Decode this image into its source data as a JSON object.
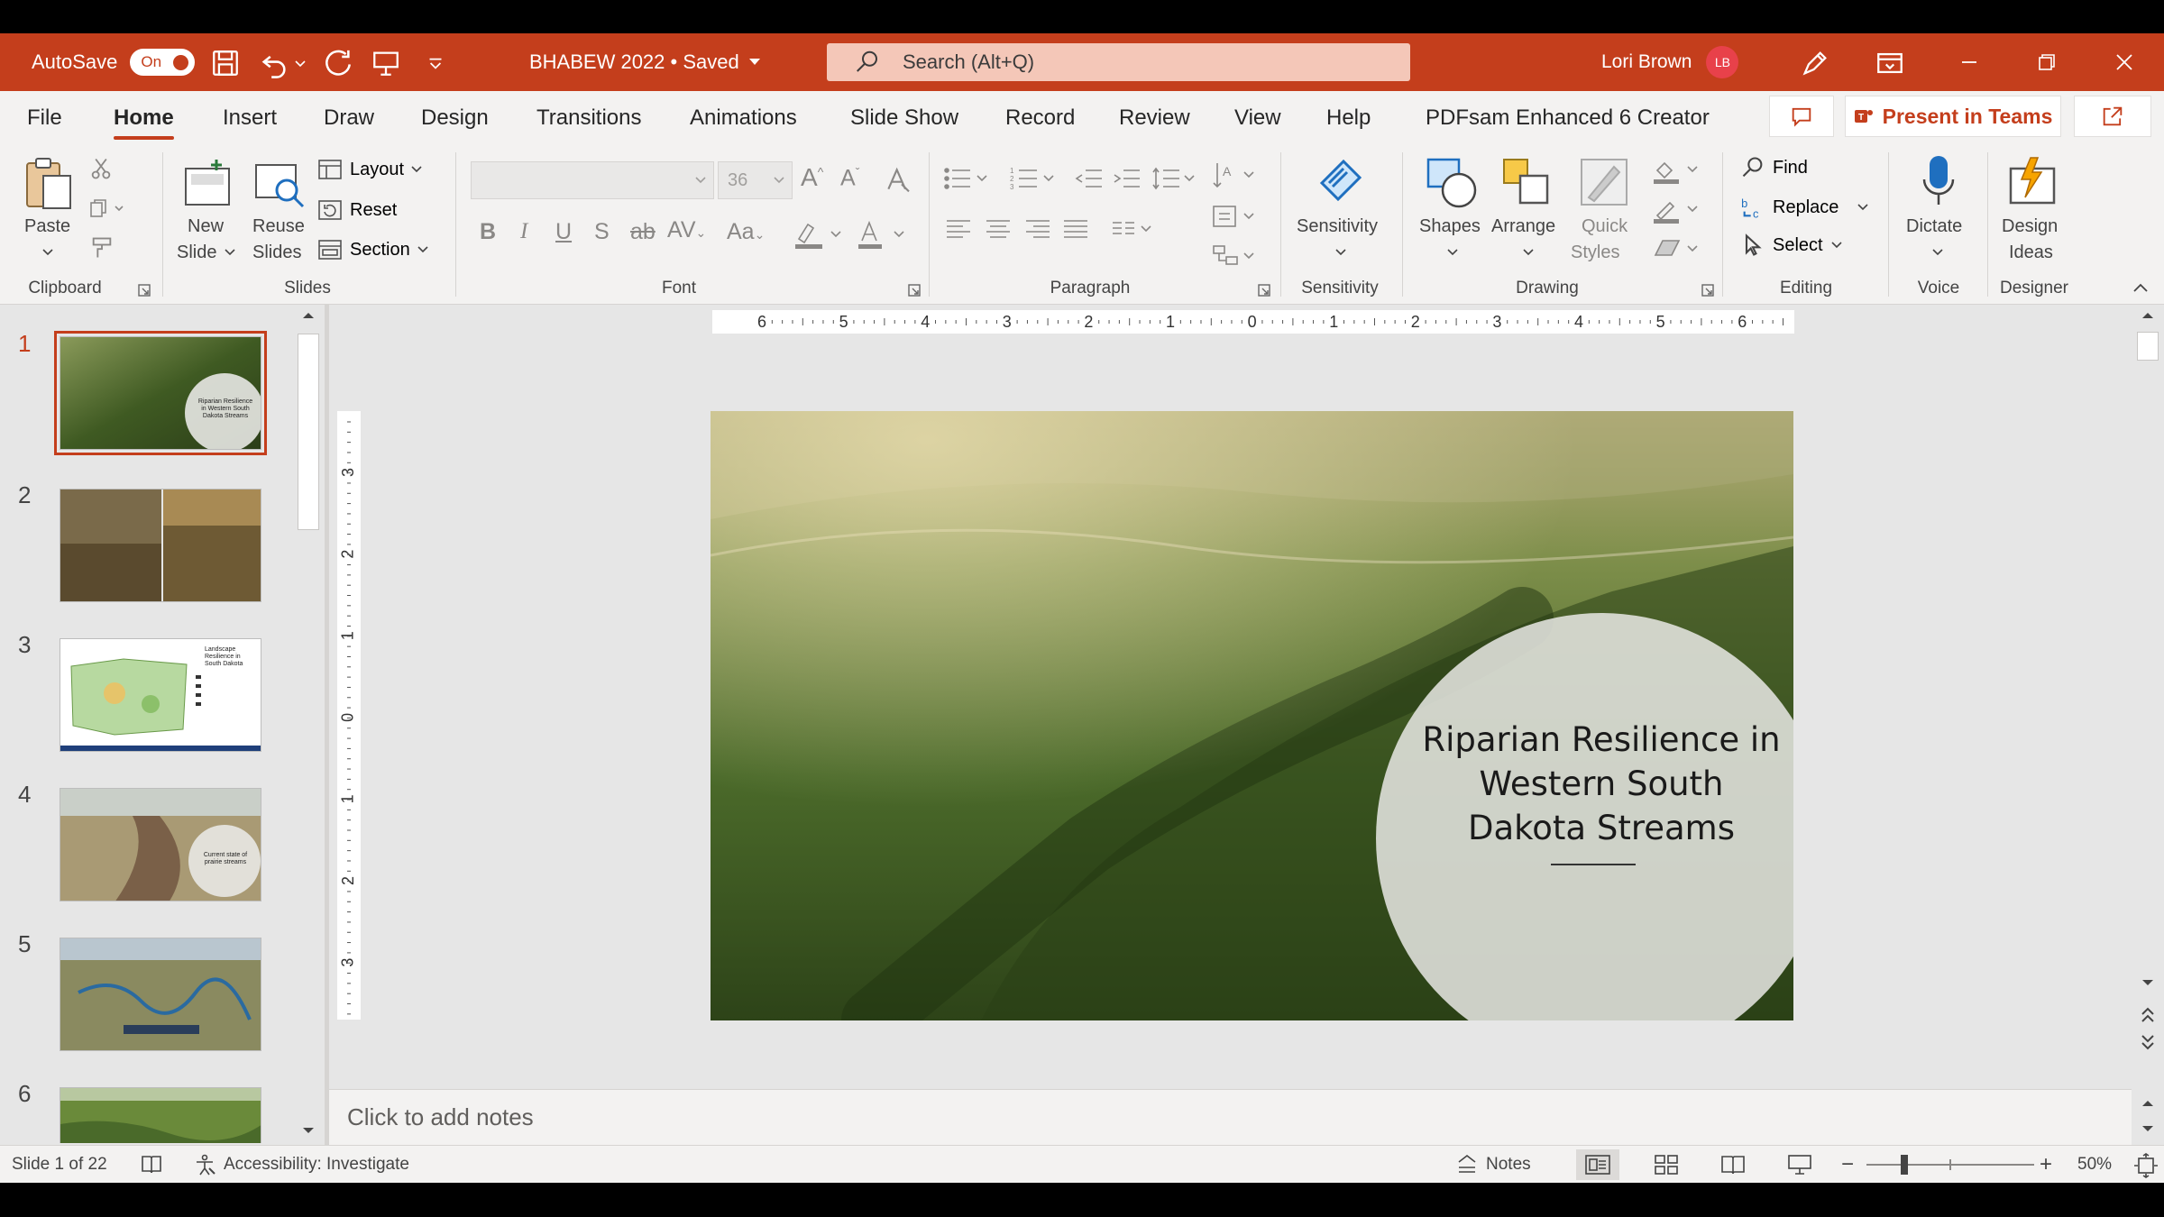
{
  "titlebar": {
    "autosave_label": "AutoSave",
    "autosave_state": "On",
    "doc_title": "BHABEW 2022 • Saved",
    "search_placeholder": "Search (Alt+Q)",
    "user_name": "Lori Brown",
    "user_initials": "LB",
    "accent_color": "#c43e1c"
  },
  "menu": {
    "tabs": [
      "File",
      "Home",
      "Insert",
      "Draw",
      "Design",
      "Transitions",
      "Animations",
      "Slide Show",
      "Record",
      "Review",
      "View",
      "Help",
      "PDFsam Enhanced 6 Creator"
    ],
    "active_tab": "Home",
    "present_in_teams": "Present in Teams"
  },
  "ribbon": {
    "clipboard": {
      "paste": "Paste",
      "group": "Clipboard"
    },
    "slides": {
      "new_slide": "New",
      "new_slide_2": "Slide",
      "reuse": "Reuse",
      "reuse_2": "Slides",
      "layout": "Layout",
      "reset": "Reset",
      "section": "Section",
      "group": "Slides"
    },
    "font": {
      "size": "36",
      "group": "Font"
    },
    "paragraph": {
      "group": "Paragraph"
    },
    "sensitivity": {
      "label": "Sensitivity",
      "group": "Sensitivity"
    },
    "drawing": {
      "shapes": "Shapes",
      "arrange": "Arrange",
      "quick": "Quick",
      "styles": "Styles",
      "group": "Drawing"
    },
    "editing": {
      "find": "Find",
      "replace": "Replace",
      "select": "Select",
      "group": "Editing"
    },
    "voice": {
      "dictate": "Dictate",
      "group": "Voice"
    },
    "designer": {
      "design": "Design",
      "ideas": "Ideas",
      "group": "Designer"
    }
  },
  "thumbnails": {
    "numbers": [
      "1",
      "2",
      "3",
      "4",
      "5",
      "6"
    ],
    "slide1_caption": "Riparian Resilience in Western South Dakota Streams",
    "slide3_caption": "Landscape Resilience in South Dakota",
    "slide4_caption": "Current state of prairie streams"
  },
  "rulers": {
    "h_ticks": [
      "6",
      "5",
      "4",
      "3",
      "2",
      "1",
      "0",
      "1",
      "2",
      "3",
      "4",
      "5",
      "6"
    ],
    "v_ticks": [
      "3",
      "2",
      "1",
      "0",
      "1",
      "2",
      "3"
    ]
  },
  "slide": {
    "title": "Riparian Resilience in Western South Dakota Streams"
  },
  "notes": {
    "placeholder": "Click to add notes"
  },
  "statusbar": {
    "slide_info": "Slide 1 of 22",
    "accessibility": "Accessibility: Investigate",
    "notes": "Notes",
    "zoom": "50%",
    "zoom_minus": "−",
    "zoom_plus": "+"
  }
}
